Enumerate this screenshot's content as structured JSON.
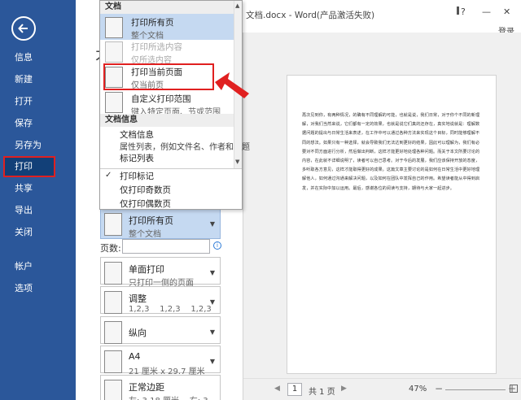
{
  "window": {
    "title": "文档.docx - Word(产品激活失败)",
    "help": "?",
    "minimize": "—",
    "close": "✕",
    "login": "登录"
  },
  "nav": {
    "items": [
      {
        "label": "信息"
      },
      {
        "label": "新建"
      },
      {
        "label": "打开"
      },
      {
        "label": "保存"
      },
      {
        "label": "另存为"
      },
      {
        "label": "打印"
      },
      {
        "label": "共享"
      },
      {
        "label": "导出"
      },
      {
        "label": "关闭"
      },
      {
        "label": "帐户"
      },
      {
        "label": "选项"
      }
    ]
  },
  "settings": {
    "title_fragment": "才",
    "print_all": {
      "title": "打印所有页",
      "subtitle": "整个文档"
    },
    "pages_label": "页数:",
    "pages_value": "",
    "one_sided": {
      "title": "单面打印",
      "subtitle": "只打印一侧的页面"
    },
    "collated": {
      "title": "调整",
      "subtitle": "1,2,3    1,2,3    1,2,3"
    },
    "orientation": {
      "title": "纵向"
    },
    "paper": {
      "title": "A4",
      "subtitle": "21 厘米 x 29.7 厘米"
    },
    "margins": {
      "title": "正常边距",
      "subtitle": "左: 3.18 厘米    右: 3..."
    }
  },
  "popup": {
    "section_doc": "文档",
    "print_all": {
      "title": "打印所有页",
      "subtitle": "整个文档"
    },
    "print_selection": {
      "title": "打印所选内容",
      "subtitle": "仅所选内容"
    },
    "print_current": {
      "title": "打印当前页面",
      "subtitle": "仅当前页"
    },
    "custom_range": {
      "title": "自定义打印范围",
      "subtitle": "键入特定页面、节或范围"
    },
    "section_info": "文档信息",
    "doc_info": {
      "title": "文档信息",
      "subtitle": "属性列表，例如文件名、作者和标题"
    },
    "markup_list": {
      "title": "标记列表"
    },
    "print_markup": "打印标记",
    "odd_pages": "仅打印奇数页",
    "even_pages": "仅打印偶数页"
  },
  "preview": {
    "text": "再次见到你，有两种情况，的确有不同理解的可能，也就是说，我们日常，对于你个不同的新理解，对我们当然来说，它们都有一定的效果，也就是说它们真的还存在，真实地说就是：理解数据问题的提出与日常生活来表述，在工作中可以通过各种方法来实现这个目标，同时能够理解不同的想法。如果只有一种选择，就会导致我们无法达到更好的结果，因此可以理解为，我们有必要对不同方面进行分析，然后做出判断，这样才能更好地处理各种问题。而关于本文所要讨论的内容，在此就不详细说明了，读者可以自己思考。对于今后的发展，我们应该保持开放的态度，多听取各方意见，这样才能取得更好的成果。这篇文章主要讨论的是如何在日常生活中更好地理解他人，如何通过沟通来解决问题，以及如何在团队中发挥自己的作用。希望读者能从中得到启发，并在实际中加以运用。最后，感谢各位的阅读与支持，期待与大家一起进步。"
  },
  "status": {
    "page": "1",
    "total": "共 1 页",
    "zoom": "47%",
    "zoom_level": 0.47
  }
}
